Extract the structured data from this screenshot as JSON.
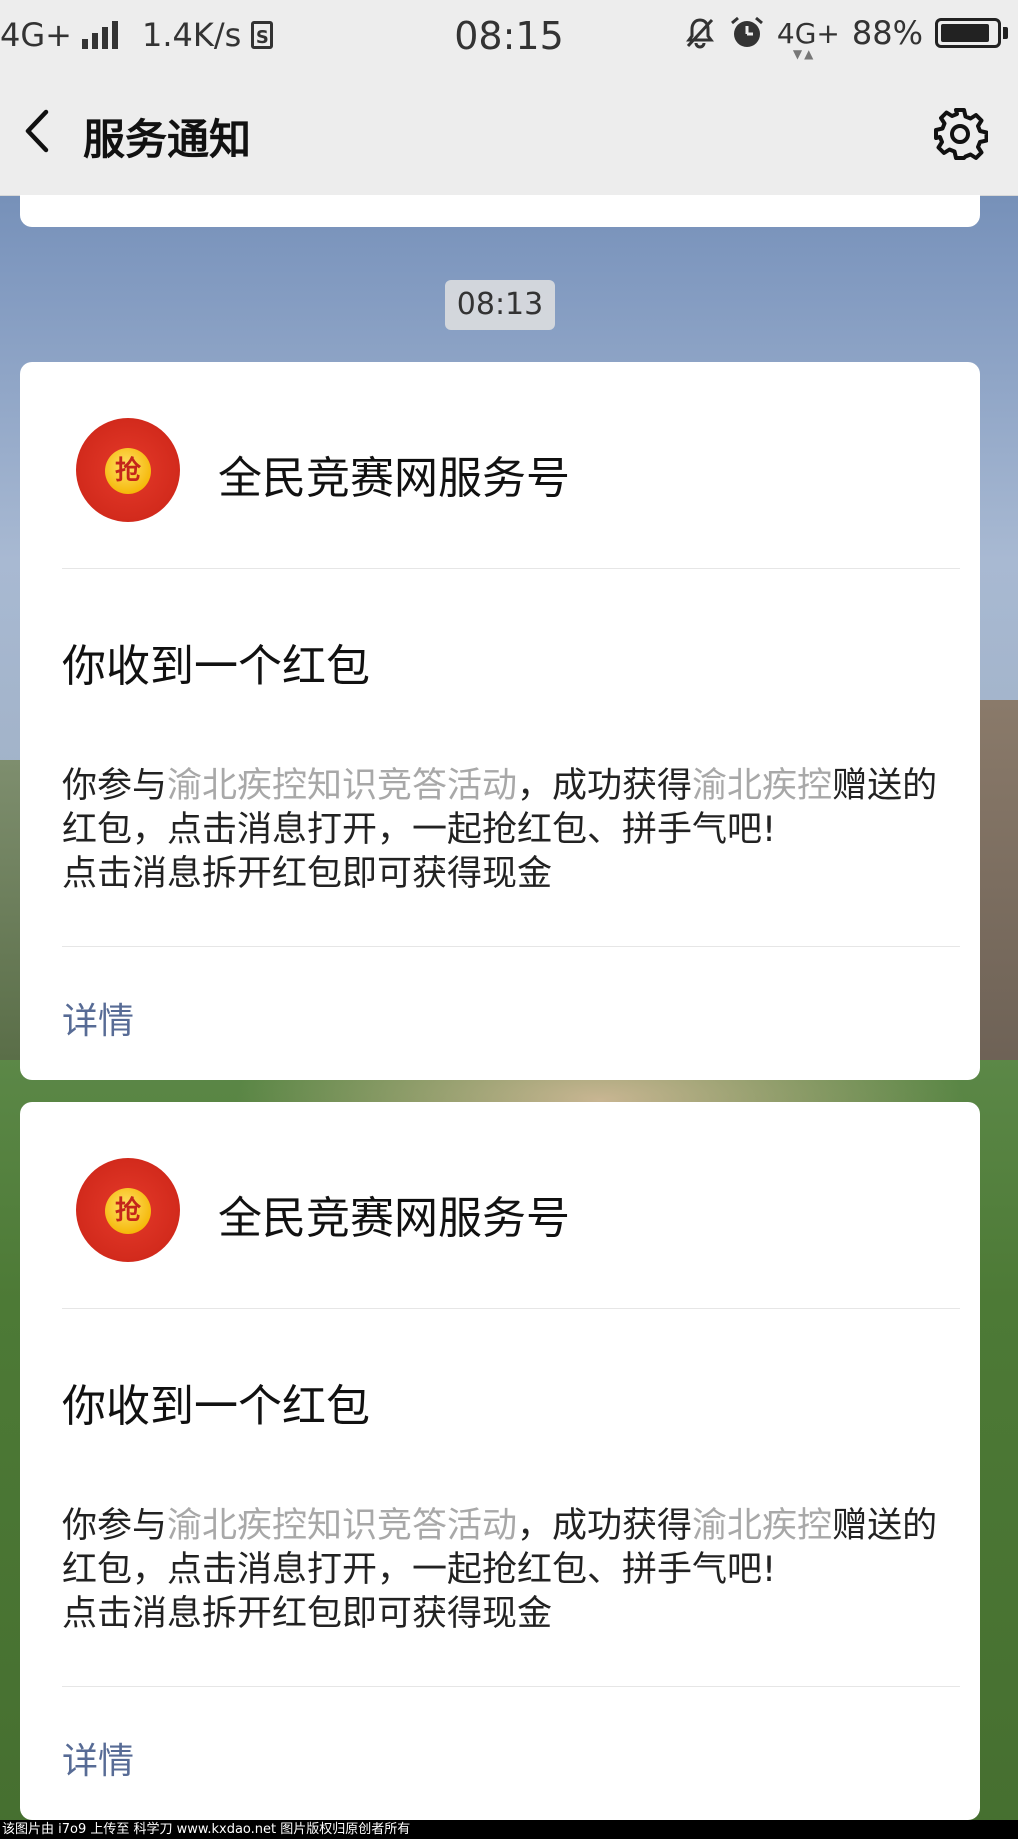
{
  "status_bar": {
    "network_left": "4G+",
    "speed": "1.4K/s",
    "sim_label": "S",
    "time": "08:15",
    "network_right": "4G+",
    "battery": "88%",
    "battery_level": 0.88
  },
  "nav": {
    "title": "服务通知"
  },
  "timestamp": "08:13",
  "cards": [
    {
      "avatar_glyph": "抢",
      "account": "全民竞赛网服务号",
      "title": "你收到一个红包",
      "body": {
        "t1": "你参与",
        "h1": "渝北疾控知识竞答活动",
        "t2": "，成功获得",
        "h2": "渝北疾控",
        "t3": "赠送的红包，点击消息打开，一起抢红包、拼手气吧!",
        "t4": "点击消息拆开红包即可获得现金"
      },
      "details": "详情"
    },
    {
      "avatar_glyph": "抢",
      "account": "全民竞赛网服务号",
      "title": "你收到一个红包",
      "body": {
        "t1": "你参与",
        "h1": "渝北疾控知识竞答活动",
        "t2": "，成功获得",
        "h2": "渝北疾控",
        "t3": "赠送的红包，点击消息打开，一起抢红包、拼手气吧!",
        "t4": "点击消息拆开红包即可获得现金"
      },
      "details": "详情"
    }
  ],
  "footer": "该图片由 i7o9 上传至 科学刀 www.kxdao.net 图片版权归原创者所有",
  "colors": {
    "link": "#576b95",
    "highlight": "#a8a8a8",
    "bar_bg": "#ededed"
  }
}
